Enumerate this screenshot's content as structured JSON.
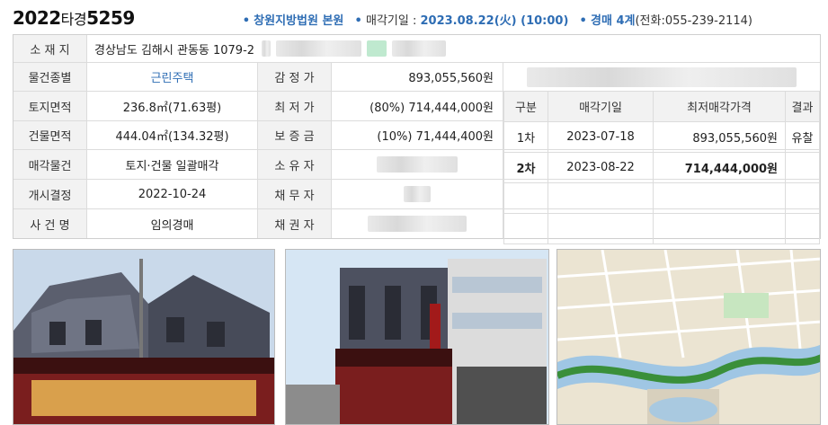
{
  "header": {
    "case_year": "2022",
    "case_type": "타경",
    "case_num": "5259",
    "court": "창원지방법원 본원",
    "sale_date_label": "매각기일 : ",
    "sale_date": "2023.08.22(火) (10:00)",
    "division": "경매 4계",
    "phone": "(전화:055-239-2114)"
  },
  "rows": [
    {
      "label": "소 재 지",
      "value": "경상남도 김해시 관동동 1079-2"
    },
    {
      "label": "물건종별",
      "value": "근린주택",
      "label2": "감 정 가",
      "value2": "893,055,560원"
    },
    {
      "label": "토지면적",
      "value": "236.8㎡(71.63평)",
      "label2": "최 저 가",
      "value2": "(80%) 714,444,000원"
    },
    {
      "label": "건물면적",
      "value": "444.04㎡(134.32평)",
      "label2": "보 증 금",
      "value2": "(10%) 71,444,400원"
    },
    {
      "label": "매각물건",
      "value": "토지·건물 일괄매각",
      "label2": "소 유 자",
      "value2": ""
    },
    {
      "label": "개시결정",
      "value": "2022-10-24",
      "label2": "채 무 자",
      "value2": ""
    },
    {
      "label": "사 건 명",
      "value": "임의경매",
      "label2": "채 권 자",
      "value2": ""
    }
  ],
  "history": {
    "headers": [
      "구분",
      "매각기일",
      "최저매각가격",
      "결과"
    ],
    "rows": [
      {
        "round": "1차",
        "date": "2023-07-18",
        "price": "893,055,560원",
        "result": "유찰"
      },
      {
        "round": "2차",
        "date": "2023-08-22",
        "price": "714,444,000원",
        "result": ""
      }
    ]
  },
  "colors": {
    "accent": "#2e6db4",
    "label_bg": "#f2f2f2"
  }
}
